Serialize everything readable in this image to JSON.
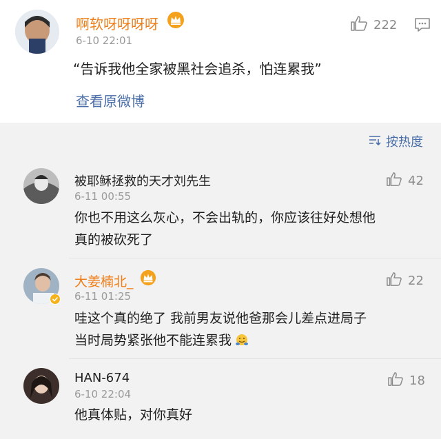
{
  "main_post": {
    "username": "啊软呀呀呀呀",
    "time": "6-10 22:01",
    "likes": "222",
    "text": "“告诉我他全家被黑社会追杀，怕连累我”",
    "view_original": "查看原微博"
  },
  "sort": {
    "label": "按热度"
  },
  "comments": [
    {
      "username": "被耶稣拯救的天才刘先生",
      "time": "6-11 00:55",
      "likes": "42",
      "lines": [
        "你也不用这么灰心，不会出轨的，你应该往好处想他",
        "真的被砍死了"
      ]
    },
    {
      "username": "大姜楠北_",
      "time": "6-11 01:25",
      "likes": "22",
      "lines": [
        "哇这个真的绝了 我前男友说他爸那会儿差点进局子",
        "当时局势紧张他不能连累我"
      ]
    },
    {
      "username": "HAN-674",
      "time": "6-10 22:04",
      "likes": "18",
      "lines": [
        "他真体贴，对你真好"
      ]
    }
  ],
  "colors": {
    "vip_name": "#ef7f1a",
    "link": "#4a6ea8",
    "normal_name": "#222222",
    "meta": "#9a9a9a"
  }
}
